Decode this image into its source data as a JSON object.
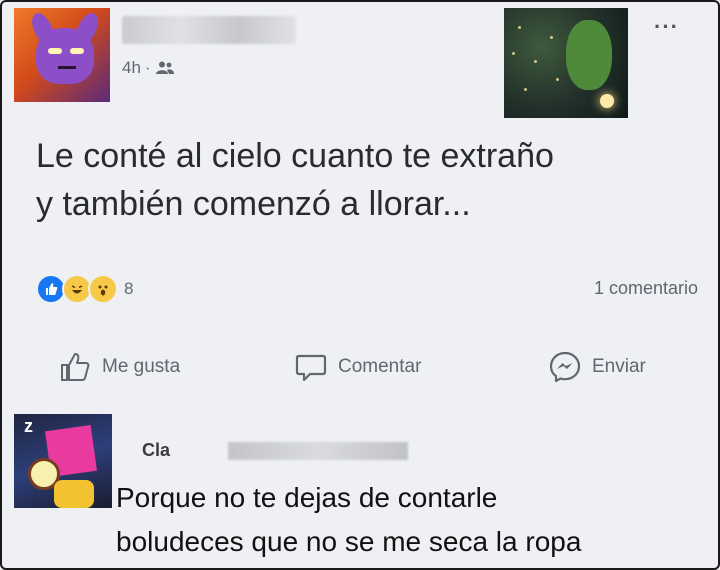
{
  "post": {
    "time": "4h",
    "time_separator": "·",
    "privacy_icon": "friends-icon",
    "text_line1": "Le conté al cielo cuanto te extraño",
    "text_line2": "y también comenzó a llorar...",
    "reactions": [
      "like",
      "haha",
      "wow"
    ],
    "reaction_count": "8",
    "comments_count": "1 comentario"
  },
  "actions": {
    "like": "Me gusta",
    "comment": "Comentar",
    "send": "Enviar"
  },
  "comment": {
    "author_visible": "Cla",
    "line1": "Porque no te dejas de contarle",
    "line2": "boludeces que no se me seca la ropa"
  },
  "colors": {
    "background": "#eef0f3",
    "accent": "#1877f2",
    "muted": "#606770"
  }
}
